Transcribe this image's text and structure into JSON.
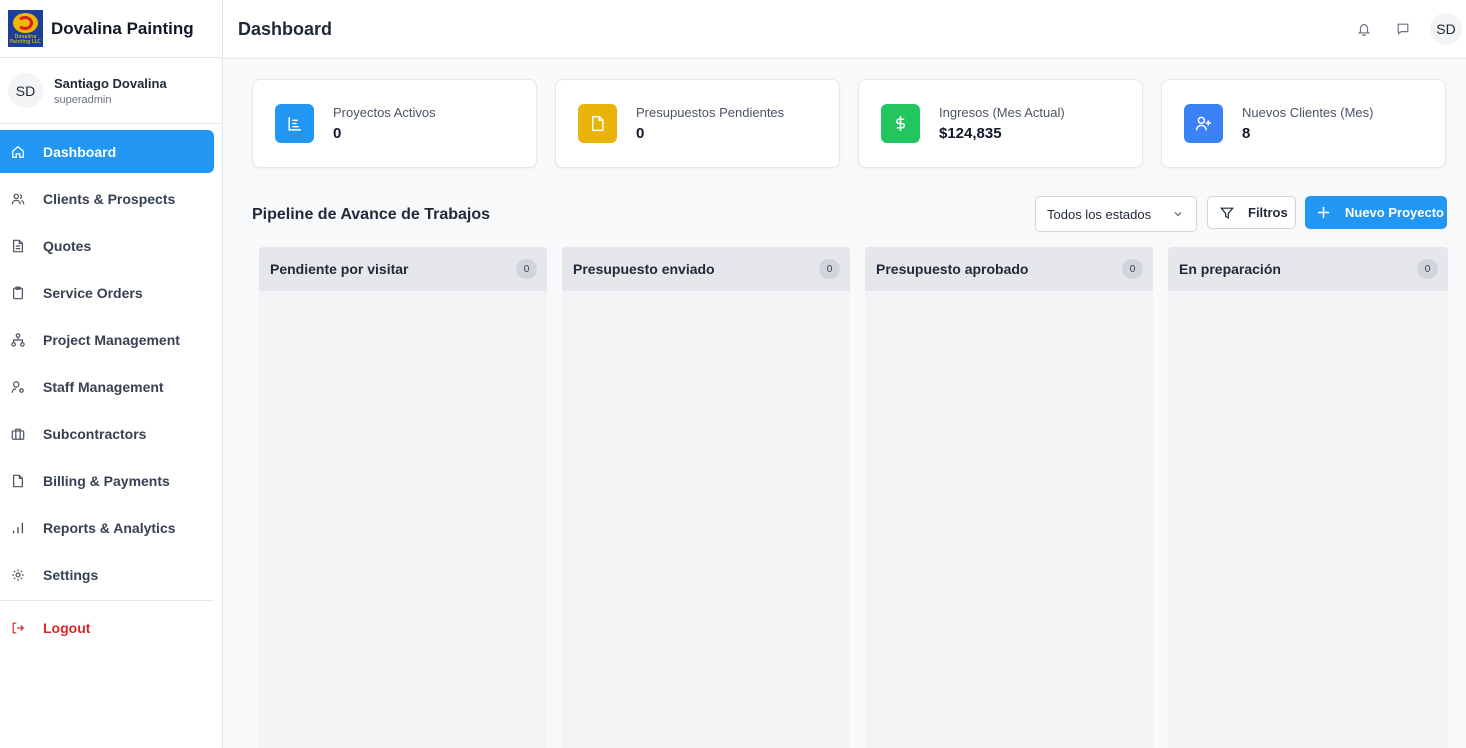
{
  "brand": {
    "name": "Dovalina Painting",
    "logo_text": "Dovalina Painting LLC"
  },
  "user": {
    "initials": "SD",
    "name": "Santiago Dovalina",
    "role": "superadmin"
  },
  "sidebar": {
    "items": [
      {
        "label": "Dashboard",
        "icon": "home-icon",
        "active": true
      },
      {
        "label": "Clients & Prospects",
        "icon": "users-icon"
      },
      {
        "label": "Quotes",
        "icon": "document-icon"
      },
      {
        "label": "Service Orders",
        "icon": "clipboard-icon"
      },
      {
        "label": "Project Management",
        "icon": "hierarchy-icon"
      },
      {
        "label": "Staff Management",
        "icon": "user-cog-icon"
      },
      {
        "label": "Subcontractors",
        "icon": "briefcase-icon"
      },
      {
        "label": "Billing & Payments",
        "icon": "file-icon"
      },
      {
        "label": "Reports & Analytics",
        "icon": "bar-chart-icon"
      },
      {
        "label": "Settings",
        "icon": "gear-icon"
      }
    ],
    "logout": {
      "label": "Logout",
      "icon": "logout-icon"
    }
  },
  "header": {
    "title": "Dashboard",
    "avatar_initials": "SD"
  },
  "stats": [
    {
      "label": "Proyectos Activos",
      "value": "0",
      "icon": "list-icon",
      "color": "#2196f3"
    },
    {
      "label": "Presupuestos Pendientes",
      "value": "0",
      "icon": "document-icon",
      "color": "#eab308"
    },
    {
      "label": "Ingresos (Mes Actual)",
      "value": "$124,835",
      "icon": "dollar-icon",
      "color": "#22c55e"
    },
    {
      "label": "Nuevos Clientes (Mes)",
      "value": "8",
      "icon": "user-plus-icon",
      "color": "#3b82f6"
    }
  ],
  "pipeline": {
    "title": "Pipeline de Avance de Trabajos",
    "status_select": "Todos los estados",
    "filter_label": "Filtros",
    "new_label": "Nuevo Proyecto",
    "columns": [
      {
        "title": "Pendiente por visitar",
        "count": "0"
      },
      {
        "title": "Presupuesto enviado",
        "count": "0"
      },
      {
        "title": "Presupuesto aprobado",
        "count": "0"
      },
      {
        "title": "En preparación",
        "count": "0"
      }
    ]
  },
  "colors": {
    "primary": "#2196f3",
    "danger": "#dc2626"
  }
}
